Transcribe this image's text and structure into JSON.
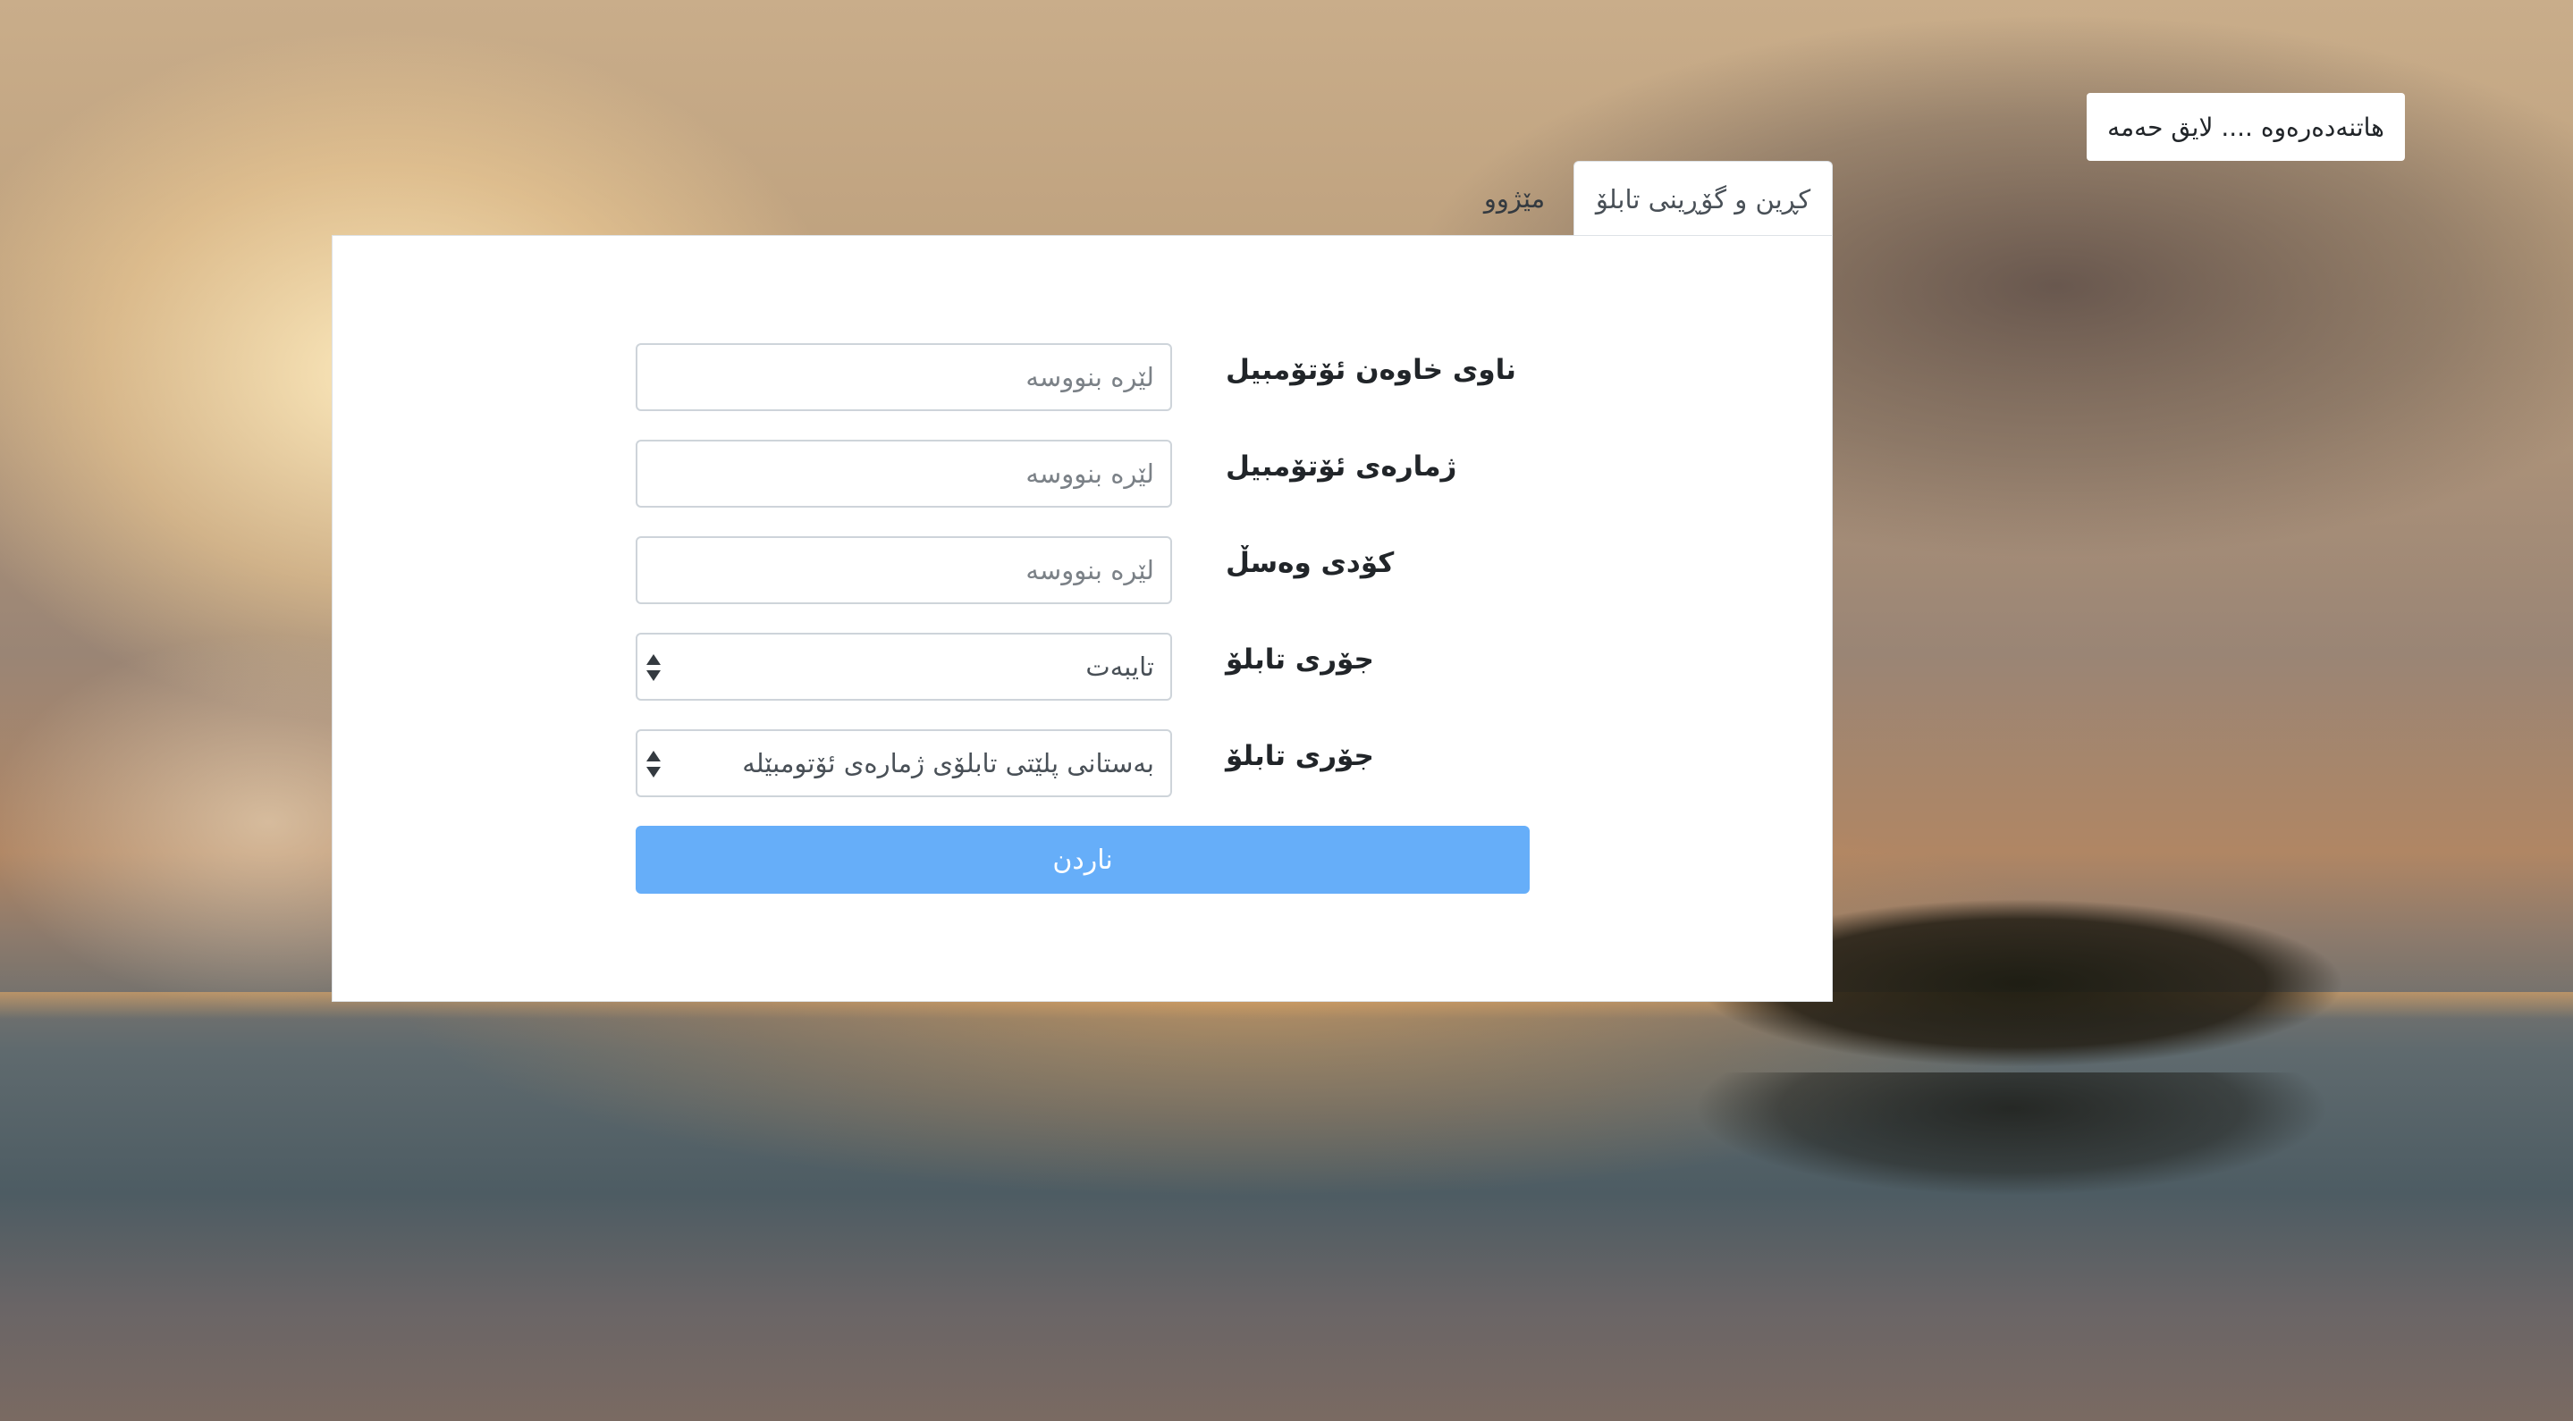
{
  "header": {
    "user_greeting": "هاتنەدەرەوە .... لایق حەمە"
  },
  "tabs": [
    {
      "label": "کڕین و گۆڕینی تابلۆ",
      "active": true
    },
    {
      "label": "مێژوو",
      "active": false
    }
  ],
  "form": {
    "fields": [
      {
        "label": "ناوی خاوەن ئۆتۆمبیل",
        "placeholder": "لێرە بنووسە",
        "value": ""
      },
      {
        "label": "ژمارەی ئۆتۆمبیل",
        "placeholder": "لێرە بنووسە",
        "value": ""
      },
      {
        "label": "کۆدی وەسڵ",
        "placeholder": "لێرە بنووسە",
        "value": ""
      }
    ],
    "selects": [
      {
        "label": "جۆری تابلۆ",
        "value": "تایبەت"
      },
      {
        "label": "جۆری تابلۆ",
        "value": "بەستانی پلێتی تابلۆی ژمارەی ئۆتومبێلە"
      }
    ],
    "submit_label": "ناردن"
  },
  "colors": {
    "submit_button": "#66aef9",
    "card_background": "#ffffff"
  },
  "icons": {
    "select_arrows": "sort-arrows-icon"
  }
}
